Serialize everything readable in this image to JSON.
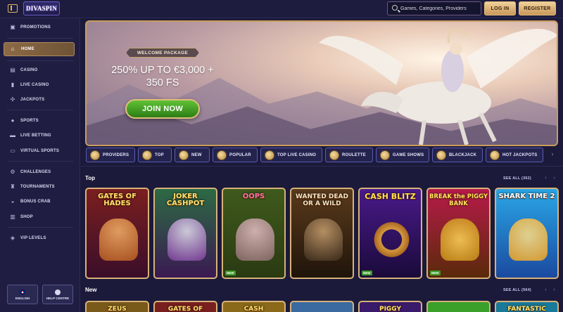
{
  "header": {
    "logo_text": "DIVASPIN",
    "search_placeholder": "Games, Categories, Providers",
    "login_label": "LOG IN",
    "register_label": "REGISTER"
  },
  "sidebar": {
    "items": [
      {
        "label": "PROMOTIONS",
        "icon": "gift-icon"
      },
      {
        "label": "HOME",
        "icon": "home-icon",
        "active": true
      },
      {
        "label": "CASINO",
        "icon": "casino-icon"
      },
      {
        "label": "LIVE CASINO",
        "icon": "live-casino-icon"
      },
      {
        "label": "JACKPOTS",
        "icon": "jackpots-icon"
      },
      {
        "label": "SPORTS",
        "icon": "sports-icon"
      },
      {
        "label": "LIVE BETTING",
        "icon": "live-betting-icon"
      },
      {
        "label": "VIRTUAL SPORTS",
        "icon": "virtual-sports-icon"
      },
      {
        "label": "CHALLENGES",
        "icon": "challenges-icon"
      },
      {
        "label": "TOURNAMENTS",
        "icon": "trophy-icon"
      },
      {
        "label": "BONUS CRAB",
        "icon": "bonus-crab-icon"
      },
      {
        "label": "SHOP",
        "icon": "shop-icon"
      },
      {
        "label": "VIP LEVELS",
        "icon": "vip-icon"
      }
    ],
    "footer": {
      "language_label": "ENGLISH",
      "help_label": "HELP CENTRE"
    }
  },
  "hero": {
    "badge": "WELCOME PACKAGE",
    "offer_line1": "250% UP TO €3,000 +",
    "offer_line2": "350 FS",
    "cta_label": "JOIN NOW"
  },
  "categories": [
    {
      "label": "PROVIDERS"
    },
    {
      "label": "TOP"
    },
    {
      "label": "NEW"
    },
    {
      "label": "POPULAR"
    },
    {
      "label": "TOP LIVE CASINO"
    },
    {
      "label": "ROULETTE"
    },
    {
      "label": "GAME SHOWS"
    },
    {
      "label": "BLACKJACK"
    },
    {
      "label": "HOT JACKPOTS"
    }
  ],
  "sections": {
    "top": {
      "title": "Top",
      "see_all": "SEE ALL (362)"
    },
    "new": {
      "title": "New",
      "see_all": "SEE ALL (564)"
    }
  },
  "games_top": [
    {
      "title": "GATES OF HADES",
      "badge": ""
    },
    {
      "title": "JOKER CASHPOT",
      "badge": ""
    },
    {
      "title": "OOPS",
      "badge": "NEW"
    },
    {
      "title": "WANTED DEAD OR A WILD",
      "badge": ""
    },
    {
      "title": "CASH BLITZ",
      "badge": "NEW"
    },
    {
      "title": "BREAK the PIGGY BANK",
      "badge": "NEW"
    },
    {
      "title": "SHARK TIME 2",
      "badge": ""
    }
  ],
  "games_new": [
    {
      "title": "ZEUS"
    },
    {
      "title": "GATES OF HADES"
    },
    {
      "title": "CASH"
    },
    {
      "title": ""
    },
    {
      "title": "PIGGY"
    },
    {
      "title": ""
    },
    {
      "title": "FANTASTIC"
    }
  ]
}
